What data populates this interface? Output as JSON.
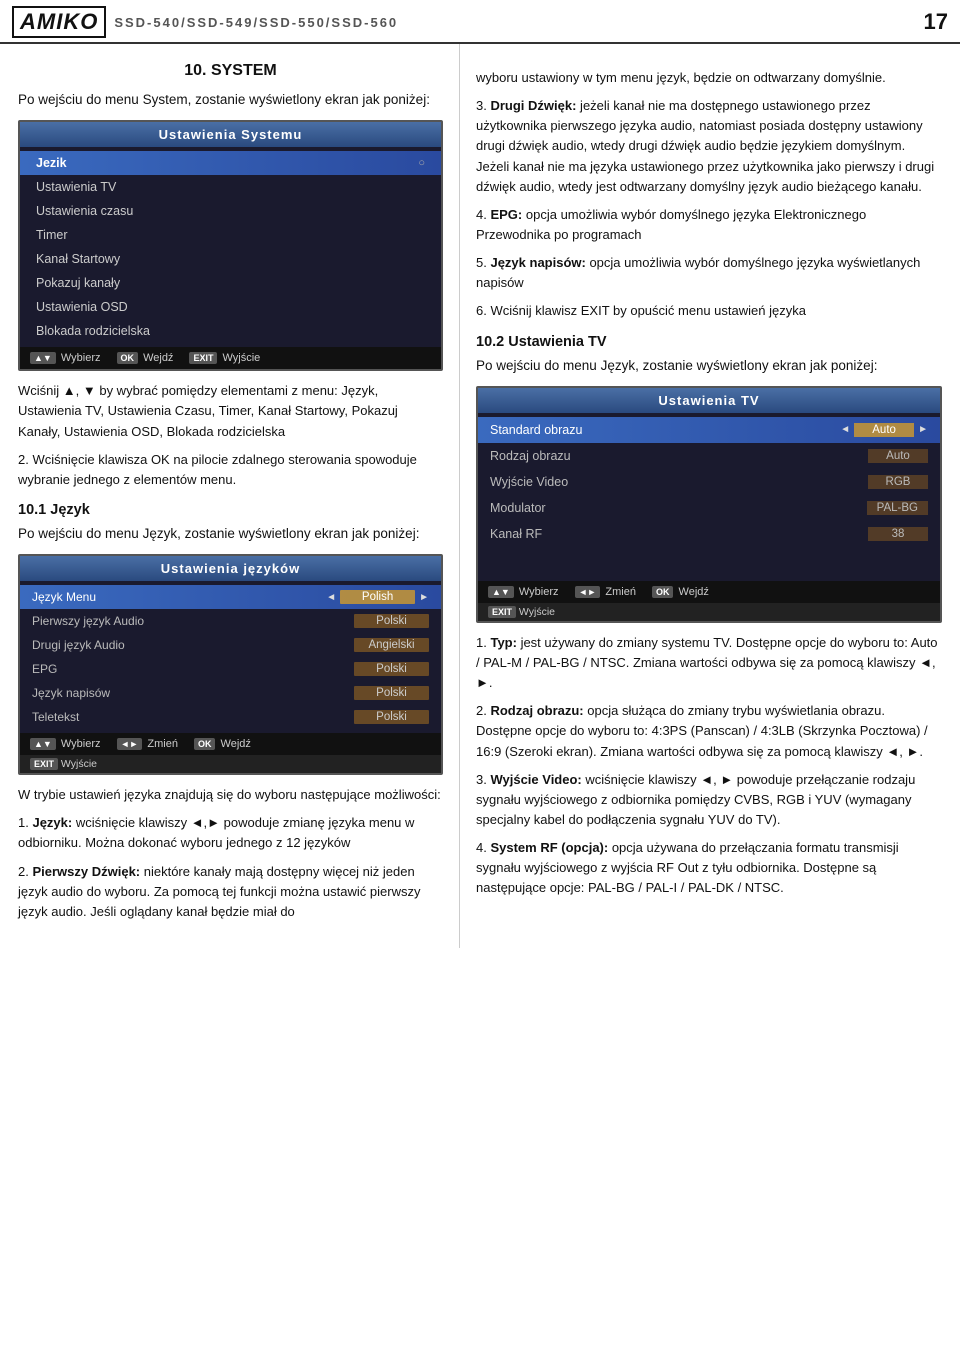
{
  "header": {
    "logo": "AMIKO",
    "model": "SSD-540/SSD-549/SSD-550/SSD-560",
    "page_number": "17"
  },
  "left_col": {
    "section_title": "10. SYSTEM",
    "intro": "Po wejściu do menu System, zostanie wyświetlony ekran jak poniżej:",
    "system_screen": {
      "title": "Ustawienia Systemu",
      "items": [
        {
          "label": "Język",
          "active": true,
          "arrow": true
        },
        {
          "label": "Ustawienia TV",
          "active": false
        },
        {
          "label": "Ustawienia czasu",
          "active": false
        },
        {
          "label": "Timer",
          "active": false
        },
        {
          "label": "Kanał Startowy",
          "active": false
        },
        {
          "label": "Pokazuj kanały",
          "active": false
        },
        {
          "label": "Ustawienia OSD",
          "active": false
        },
        {
          "label": "Blokada rodzicielska",
          "active": false
        }
      ],
      "bottom": [
        {
          "icon": "▲▼",
          "label": "Wybierz"
        },
        {
          "icon": "OK",
          "label": "Wejdź"
        },
        {
          "icon": "EXIT",
          "label": "Wyjście"
        }
      ]
    },
    "nav_instructions": [
      "Wciśnij ▲, ▼ by wybrać pomiędzy elementami z menu: Język, Ustawienia TV, Ustawienia Czasu, Timer, Kanał Startowy, Pokazuj Kanały, Ustawienia OSD, Blokada rodzicielska",
      "Wciśnięcie klawisza OK na pilocie zdalnego sterowania spowoduje wybranie jednego z elementów menu."
    ],
    "lang_section_title": "10.1 Język",
    "lang_intro": "Po wejściu do menu Język, zostanie wyświetlony ekran jak poniżej:",
    "lang_screen": {
      "title": "Ustawienia języków",
      "rows": [
        {
          "label": "Język Menu",
          "value": "Polish",
          "active": true,
          "has_arrows": true
        },
        {
          "label": "Pierwszy język Audio",
          "value": "Polski",
          "active": false
        },
        {
          "label": "Drugi język Audio",
          "value": "Angielski",
          "active": false
        },
        {
          "label": "EPG",
          "value": "Polski",
          "active": false
        },
        {
          "label": "Język napisów",
          "value": "Polski",
          "active": false
        },
        {
          "label": "Teletekst",
          "value": "Polski",
          "active": false
        }
      ],
      "bottom_row1": [
        {
          "icon": "▲▼",
          "label": "Wybierz"
        },
        {
          "icon": "◄►",
          "label": "Zmień"
        },
        {
          "icon": "OK",
          "label": "Wejdź"
        }
      ],
      "bottom_row2": [
        {
          "icon": "EXIT",
          "label": "Wyjście"
        }
      ]
    },
    "lang_body_intro": "W trybie ustawień języka znajdują się do wyboru następujące możliwości:",
    "lang_items": [
      {
        "num": "1.",
        "bold": "Język:",
        "text": " wciśnięcie klawiszy ◄,► powoduje zmianę języka menu w odbiorniku. Można dokonać wyboru jednego z 12 języków"
      },
      {
        "num": "2.",
        "bold": "Pierwszy Dźwięk:",
        "text": " niektóre kanały mają dostępny więcej niż jeden język audio do wyboru. Za pomocą tej funkcji można ustawić pierwszy język audio. Jeśli oglądany kanał będzie miał do"
      }
    ]
  },
  "right_col": {
    "right_intro": "wyboru ustawiony w tym menu język, będzie on odtwarzany domyślnie.",
    "right_items": [
      {
        "num": "3.",
        "bold": "Drugi Dźwięk:",
        "text": " jeżeli kanał nie ma dostępnego ustawionego przez użytkownika pierwszego języka audio, natomiast posiada dostępny ustawiony drugi dźwięk audio, wtedy drugi dźwięk audio będzie językiem domyślnym. Jeżeli kanał nie ma języka ustawionego przez użytkownika jako pierwszy i drugi dźwięk audio, wtedy jest odtwarzany domyślny język audio bieżącego kanału."
      },
      {
        "num": "4.",
        "bold": "EPG:",
        "text": " opcja umożliwia wybór domyślnego języka Elektronicznego Przewodnika po programach"
      },
      {
        "num": "5.",
        "bold": "Język napisów:",
        "text": " opcja umożliwia wybór domyślnego języka wyświetlanych napisów"
      },
      {
        "num": "6.",
        "text": "Wciśnij klawisz EXIT by opuścić menu ustawień języka"
      }
    ],
    "tv_section_title": "10.2 Ustawienia TV",
    "tv_intro": "Po wejściu do menu Język, zostanie wyświetlony ekran jak poniżej:",
    "tv_screen": {
      "title": "Ustawienia TV",
      "rows": [
        {
          "label": "Standard obrazu",
          "value": "Auto",
          "active": true,
          "bright": true
        },
        {
          "label": "Rodzaj obrazu",
          "value": "Auto",
          "active": false,
          "bright": false
        },
        {
          "label": "Wyjście Video",
          "value": "RGB",
          "active": false,
          "bright": false
        },
        {
          "label": "Modulator",
          "value": "PAL-BG",
          "active": false,
          "bright": false
        },
        {
          "label": "Kanał RF",
          "value": "38",
          "active": false,
          "bright": false
        }
      ],
      "bottom_row1": [
        {
          "icon": "▲▼",
          "label": "Wybierz"
        },
        {
          "icon": "◄►",
          "label": "Zmień"
        },
        {
          "icon": "OK",
          "label": "Wejdź"
        }
      ],
      "bottom_row2": [
        {
          "icon": "EXIT",
          "label": "Wyjście"
        }
      ]
    },
    "tv_items": [
      {
        "num": "1.",
        "bold": "Typ:",
        "text": " jest używany do zmiany systemu TV. Dostępne opcje do wyboru to: Auto / PAL-M / PAL-BG / NTSC. Zmiana wartości odbywa się za pomocą klawiszy ◄, ►."
      },
      {
        "num": "2.",
        "bold": "Rodzaj obrazu:",
        "text": " opcja służąca do zmiany trybu wyświetlania obrazu. Dostępne opcje do wyboru to: 4:3PS (Panscan) / 4:3LB (Skrzynka Pocztowa) / 16:9 (Szeroki ekran). Zmiana wartości odbywa się za pomocą klawiszy ◄, ►."
      },
      {
        "num": "3.",
        "bold": "Wyjście Video:",
        "text": " wciśnięcie klawiszy ◄, ► powoduje przełączanie rodzaju sygnału wyjściowego z odbiornika pomiędzy CVBS, RGB i YUV (wymagany specjalny kabel do podłączenia sygnału YUV do TV)."
      },
      {
        "num": "4.",
        "bold": "System RF (opcja):",
        "text": " opcja używana do przełączania formatu transmisji sygnału wyjściowego z wyjścia RF Out z tyłu odbiornika. Dostępne są następujące opcje: PAL-BG / PAL-I / PAL-DK / NTSC."
      }
    ]
  }
}
